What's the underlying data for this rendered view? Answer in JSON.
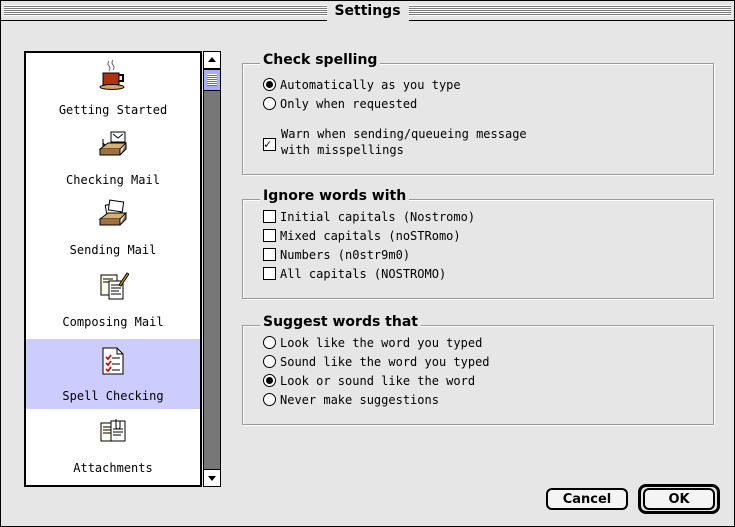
{
  "window": {
    "title": "Settings"
  },
  "sidebar": {
    "items": [
      {
        "label": "Getting Started",
        "icon": "coffee-cup-icon",
        "selected": false
      },
      {
        "label": "Checking Mail",
        "icon": "inbox-tray-icon",
        "selected": false
      },
      {
        "label": "Sending Mail",
        "icon": "outbox-tray-icon",
        "selected": false
      },
      {
        "label": "Composing Mail",
        "icon": "compose-document-icon",
        "selected": false
      },
      {
        "label": "Spell Checking",
        "icon": "checklist-icon",
        "selected": true
      },
      {
        "label": "Attachments",
        "icon": "attachment-documents-icon",
        "selected": false
      }
    ]
  },
  "check_spelling": {
    "title": "Check spelling",
    "options": [
      {
        "label": "Automatically as you type",
        "selected": true
      },
      {
        "label": "Only when requested",
        "selected": false
      }
    ],
    "warn": {
      "line1": "Warn when sending/queueing message",
      "line2": "with misspellings",
      "checked": true
    }
  },
  "ignore_words": {
    "title": "Ignore words with",
    "options": [
      {
        "label": "Initial capitals (Nostromo)",
        "checked": false
      },
      {
        "label": "Mixed capitals (noSTRomo)",
        "checked": false
      },
      {
        "label": "Numbers (n0str9m0)",
        "checked": false
      },
      {
        "label": "All capitals (NOSTROMO)",
        "checked": false
      }
    ]
  },
  "suggest_words": {
    "title": "Suggest words that",
    "options": [
      {
        "label": "Look like the word you typed",
        "selected": false
      },
      {
        "label": "Sound like the word you typed",
        "selected": false
      },
      {
        "label": "Look or sound like the word",
        "selected": true
      },
      {
        "label": "Never make suggestions",
        "selected": false
      }
    ]
  },
  "buttons": {
    "cancel": "Cancel",
    "ok": "OK"
  },
  "colors": {
    "selection": "#ccccff",
    "window_bg": "#e6e6e6"
  }
}
